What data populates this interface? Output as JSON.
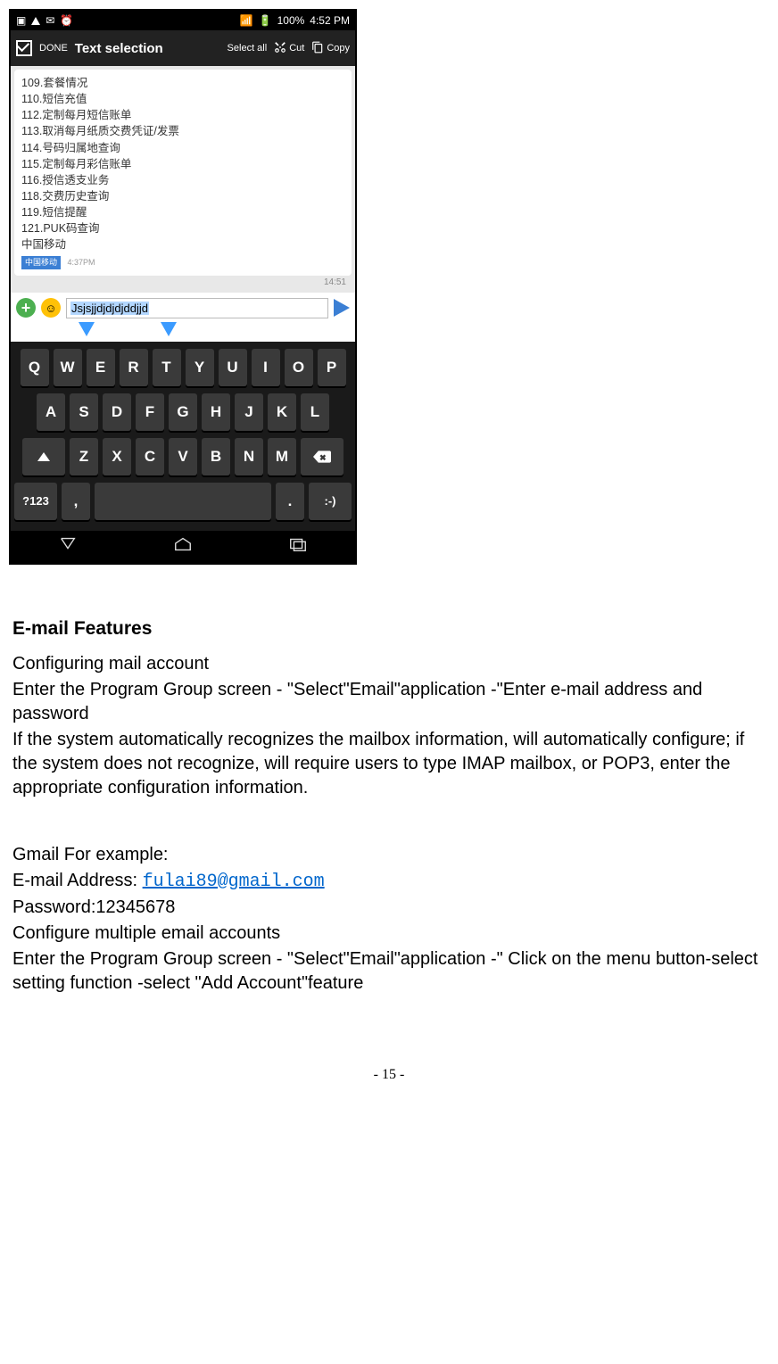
{
  "phone": {
    "status": {
      "battery": "100%",
      "time": "4:52 PM"
    },
    "actionbar": {
      "done": "DONE",
      "title": "Text selection",
      "select_all": "Select all",
      "cut": "Cut",
      "copy": "Copy"
    },
    "message_lines": [
      "109.套餐情况",
      "110.短信充值",
      "112.定制每月短信账单",
      "113.取消每月纸质交费凭证/发票",
      "114.号码归属地查询",
      "115.定制每月彩信账单",
      "116.授信透支业务",
      "118.交费历史查询",
      "119.短信提醒",
      "121.PUK码查询",
      "中国移动"
    ],
    "sender_time": "4:37PM",
    "timestamp_right": "14:51",
    "compose_value": "Jsjsjjdjdjdjddjjd",
    "keyboard": {
      "row1": [
        "Q",
        "W",
        "E",
        "R",
        "T",
        "Y",
        "U",
        "I",
        "O",
        "P"
      ],
      "row2": [
        "A",
        "S",
        "D",
        "F",
        "G",
        "H",
        "J",
        "K",
        "L"
      ],
      "row3": [
        "Z",
        "X",
        "C",
        "V",
        "B",
        "N",
        "M"
      ],
      "sym": "?123",
      "comma": ",",
      "period": ".",
      "smile": ":-)"
    }
  },
  "doc": {
    "heading": "E-mail Features",
    "p1": "Configuring mail account",
    "p2": "Enter the Program Group screen - \"Select\"Email\"application -\"Enter e-mail address and password",
    "p3": "If the system automatically recognizes the mailbox information, will automatically configure; if the system does not recognize, will require users to type IMAP mailbox, or POP3, enter the appropriate configuration information.",
    "p4": "Gmail For example:",
    "p5a": "E-mail Address: ",
    "email": "fulai89@gmail.com",
    "p6": "Password:12345678",
    "p7": "Configure multiple email accounts",
    "p8": "Enter the Program Group screen - \"Select\"Email\"application -\" Click on the menu button-select setting function -select \"Add Account\"feature",
    "pagenum": "- 15 -"
  }
}
